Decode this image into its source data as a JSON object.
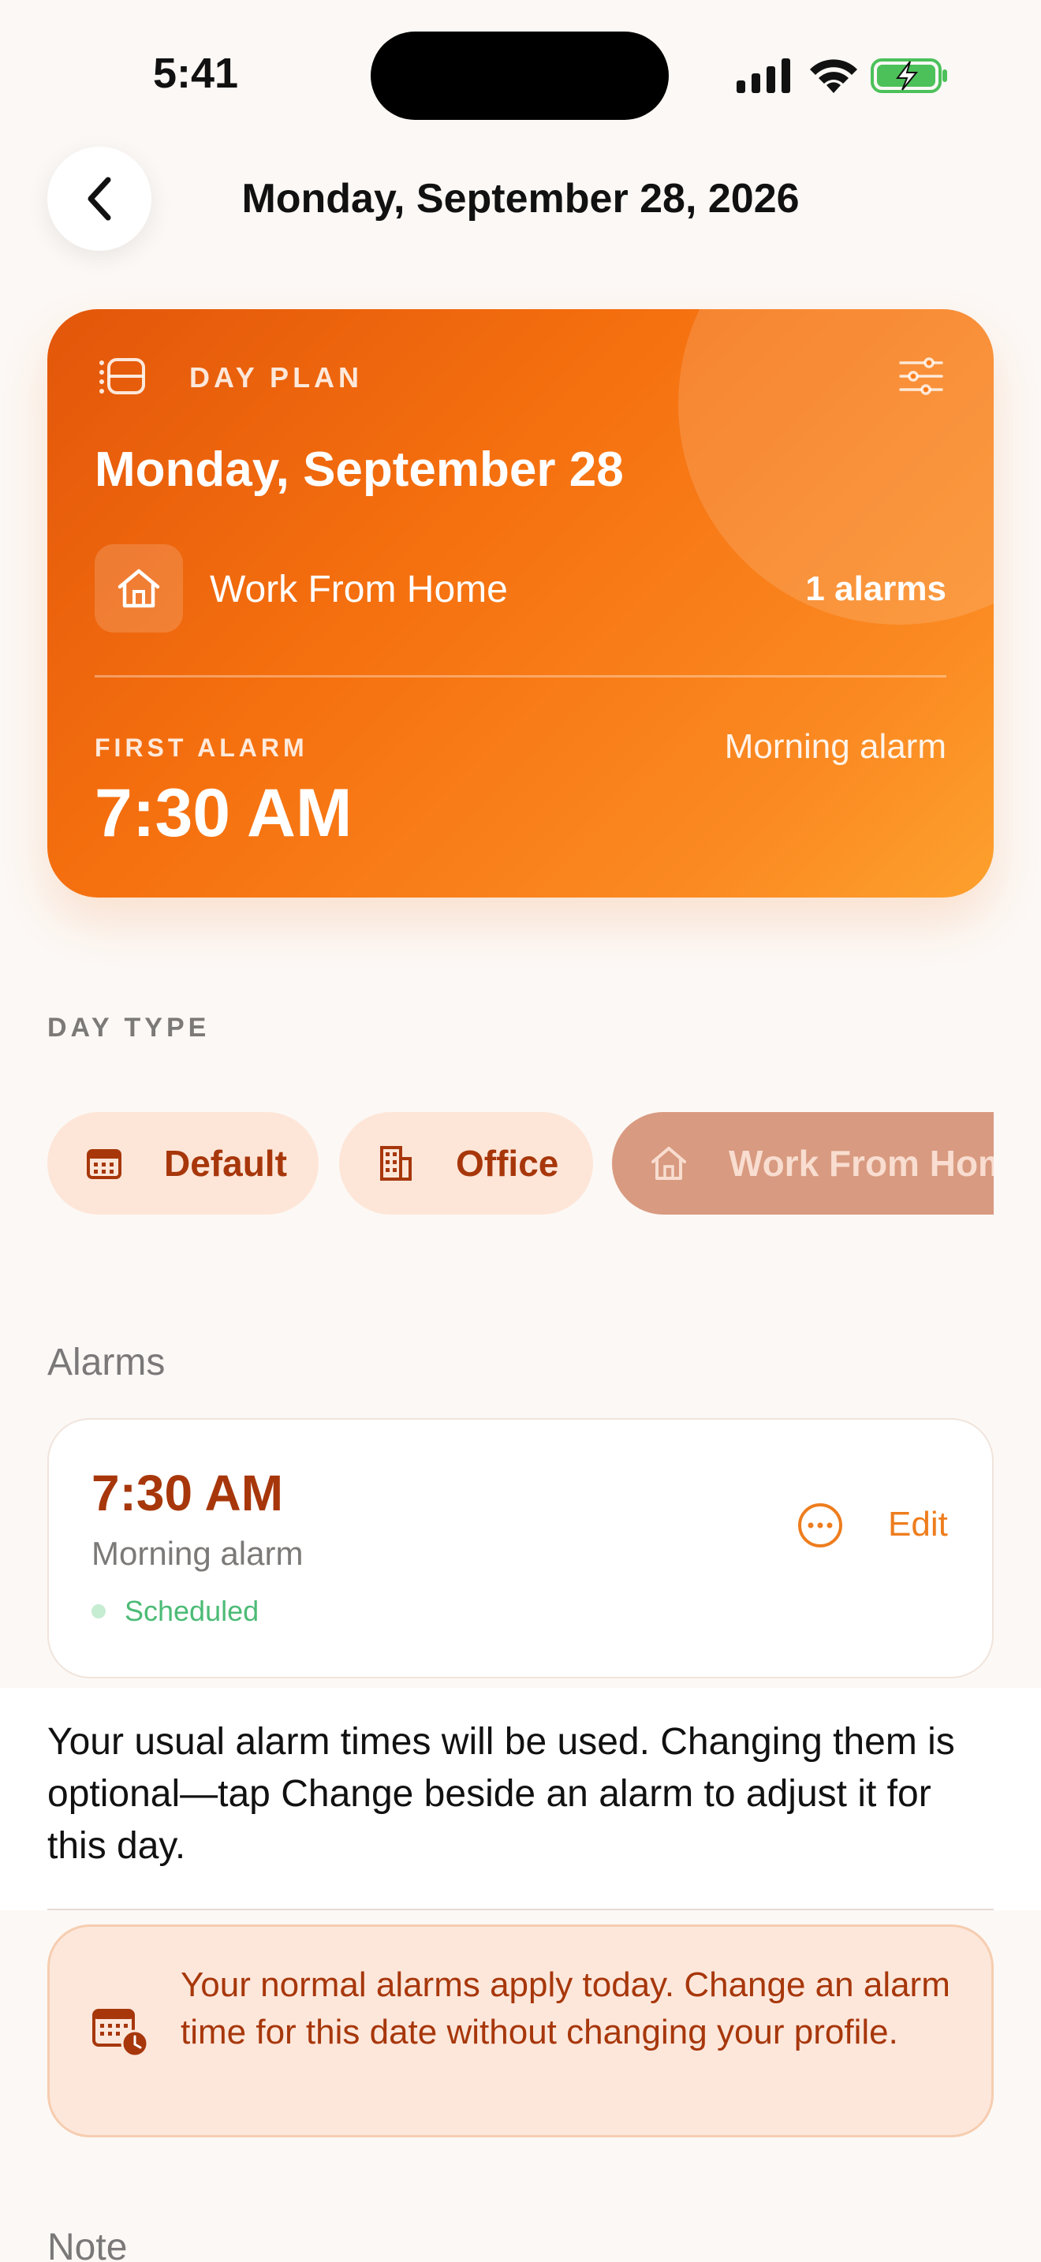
{
  "status_bar": {
    "time": "5:41"
  },
  "header": {
    "title": "Monday, September 28, 2026"
  },
  "day_plan": {
    "label": "DAY PLAN",
    "date": "Monday, September 28",
    "day_type": "Work From Home",
    "alarm_count": "1 alarms",
    "first_alarm_label": "FIRST ALARM",
    "first_alarm_time": "7:30 AM",
    "first_alarm_name": "Morning alarm"
  },
  "day_type_section": {
    "label": "DAY TYPE",
    "options": [
      {
        "label": "Default",
        "icon": "calendar-icon",
        "selected": false
      },
      {
        "label": "Office",
        "icon": "building-icon",
        "selected": false
      },
      {
        "label": "Work From Home",
        "icon": "home-icon",
        "selected": true
      }
    ]
  },
  "alarms": {
    "title": "Alarms",
    "items": [
      {
        "time": "7:30 AM",
        "name": "Morning alarm",
        "status": "Scheduled",
        "edit_label": "Edit"
      }
    ]
  },
  "info_text": "Your usual alarm times will be used. Changing them is optional—tap Change beside an alarm to adjust it for this day.",
  "notice_text": "Your normal alarms apply today. Change an alarm time for this date without changing your profile.",
  "note_label": "Note",
  "colors": {
    "accent": "#f5700f",
    "accent_dark": "#a7370b",
    "scheduled": "#4cbb76",
    "background": "#fcf8f5"
  }
}
